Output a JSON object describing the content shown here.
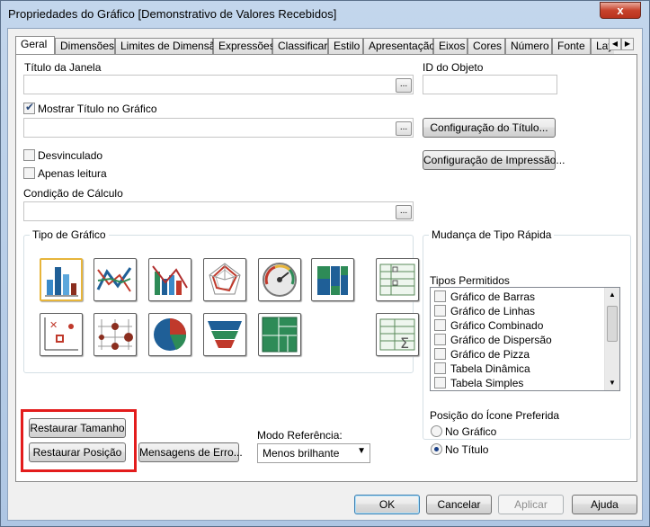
{
  "window": {
    "title": "Propriedades do Gráfico [Demonstrativo de Valores Recebidos]",
    "close_glyph": "x"
  },
  "tabs": [
    "Geral",
    "Dimensões",
    "Limites de Dimensão",
    "Expressões",
    "Classificar",
    "Estilo",
    "Apresentação",
    "Eixos",
    "Cores",
    "Número",
    "Fonte",
    "Layo"
  ],
  "active_tab": "Geral",
  "general": {
    "window_title_label": "Título da Janela",
    "window_title_value": "",
    "object_id_label": "ID do Objeto",
    "object_id_value": "",
    "show_title_label": "Mostrar Título no Gráfico",
    "show_title_checked": true,
    "chart_title_value": "",
    "title_config_button": "Configuração do Título...",
    "print_config_button": "Configuração de Impressão...",
    "detached_label": "Desvinculado",
    "read_only_label": "Apenas leitura",
    "calc_condition_label": "Condição de Cálculo",
    "calc_condition_value": "",
    "ellipsis": "..."
  },
  "chart_type": {
    "group_label": "Tipo de Gráfico",
    "icons": [
      "bar-chart-icon",
      "line-chart-icon",
      "combo-chart-icon",
      "radar-chart-icon",
      "gauge-chart-icon",
      "mekko-chart-icon",
      "pivot-table-icon",
      "scatter-chart-icon",
      "grid-chart-icon",
      "pie-chart-icon",
      "funnel-chart-icon",
      "block-chart-icon",
      "straight-table-icon"
    ],
    "selected": "bar-chart-icon"
  },
  "quick_change": {
    "group_label": "Mudança de Tipo Rápida",
    "allowed_label": "Tipos Permitidos",
    "items": [
      "Gráfico de Barras",
      "Gráfico de Linhas",
      "Gráfico Combinado",
      "Gráfico de Dispersão",
      "Gráfico de Pizza",
      "Tabela Dinâmica",
      "Tabela Simples"
    ],
    "icon_position_label": "Posição do Ícone Preferida",
    "icon_position_options": [
      "No Gráfico",
      "No Título"
    ],
    "icon_position_selected": "No Título"
  },
  "bottom": {
    "restore_size_button": "Restaurar Tamanho",
    "restore_position_button": "Restaurar Posição",
    "error_messages_button": "Mensagens de Erro...",
    "ref_mode_label": "Modo Referência:",
    "ref_mode_value": "Menos brilhante"
  },
  "footer": {
    "ok": "OK",
    "cancel": "Cancelar",
    "apply": "Aplicar",
    "help": "Ajuda"
  },
  "colors": {
    "highlight": "#e31c1c",
    "selected_icon_border": "#e7b53b"
  }
}
